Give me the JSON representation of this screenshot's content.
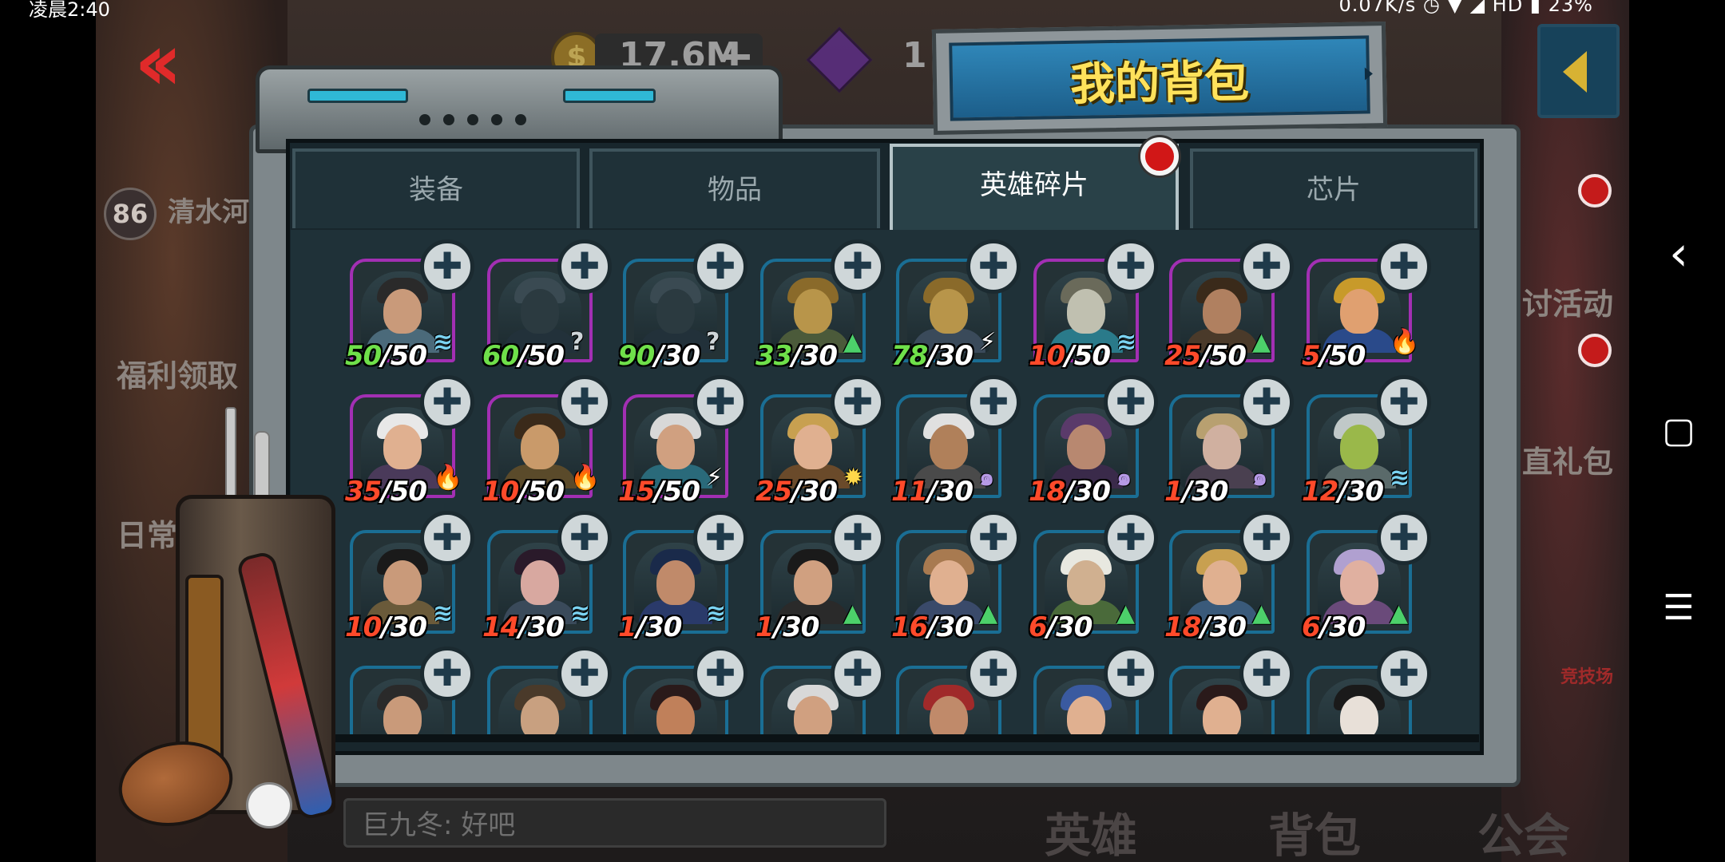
{
  "status_bar": {
    "time": "凌晨2:40",
    "right": "0.07K/s ◷ ▼ ◢ HD ▮ 23%"
  },
  "background": {
    "level": "86",
    "player_name": "清水河",
    "welfare_label": "福利领取",
    "daily_label": "日常任",
    "gold_amount": "17.6M",
    "gold_icon_glyph": "$",
    "plus_glyph": "+",
    "gem_amount": "1",
    "event_label": "讨活动",
    "gift_label": "直礼包",
    "arena_label": "竞技场",
    "chat_text": "巨九冬: 好吧",
    "bottom_tabs": [
      "英雄",
      "背包",
      "公会"
    ]
  },
  "panel": {
    "title": "我的背包",
    "tabs": [
      {
        "label": "装备",
        "active": false
      },
      {
        "label": "物品",
        "active": false
      },
      {
        "label": "英雄碎片",
        "active": true
      },
      {
        "label": "芯片",
        "active": false
      }
    ]
  },
  "element_icons": {
    "water": {
      "glyph": "≋",
      "icon": "water-element-icon"
    },
    "fire": {
      "glyph": "🔥",
      "icon": "fire-element-icon"
    },
    "bolt": {
      "glyph": "⚡",
      "icon": "lightning-element-icon"
    },
    "sun": {
      "glyph": "✹",
      "icon": "sun-element-icon"
    },
    "spiral": {
      "glyph": "๑",
      "icon": "spiral-element-icon"
    },
    "mount": {
      "glyph": "▲",
      "icon": "mountain-element-icon"
    },
    "unknown": {
      "glyph": "?",
      "icon": "unknown-element-icon"
    }
  },
  "puzzle_glyph": "✚",
  "android_nav": {
    "back": "‹",
    "home": "▢",
    "menu": "☰"
  },
  "hero_shards": [
    {
      "have": "50",
      "need": "/50",
      "frame": "purple",
      "element": "water",
      "have_color": "green",
      "skin": "#c99a7a",
      "hair": "#2a2a2a",
      "cloth": "#4b6a7a"
    },
    {
      "have": "60",
      "need": "/50",
      "frame": "purple",
      "element": "unknown",
      "have_color": "green",
      "skin": "#2b3a40",
      "hair": "#3a4a52",
      "cloth": "#22313a"
    },
    {
      "have": "90",
      "need": "/30",
      "frame": "blue",
      "element": "unknown",
      "have_color": "green",
      "skin": "#2b3a40",
      "hair": "#3a4a52",
      "cloth": "#22313a"
    },
    {
      "have": "33",
      "need": "/30",
      "frame": "blue",
      "element": "mount",
      "have_color": "green",
      "skin": "#b8954a",
      "hair": "#8a6a2a",
      "cloth": "#4b5a3a"
    },
    {
      "have": "78",
      "need": "/30",
      "frame": "blue",
      "element": "bolt",
      "have_color": "green",
      "skin": "#b8954a",
      "hair": "#8a6a2a",
      "cloth": "#3a4a5a"
    },
    {
      "have": "10",
      "need": "/50",
      "frame": "purple",
      "element": "water",
      "have_color": "red",
      "skin": "#c0c0b0",
      "hair": "#6a6a5a",
      "cloth": "#2a7a8a"
    },
    {
      "have": "25",
      "need": "/50",
      "frame": "purple",
      "element": "mount",
      "have_color": "red",
      "skin": "#b08060",
      "hair": "#3a2a1a",
      "cloth": "#4a3a2a"
    },
    {
      "have": "5",
      "need": "/50",
      "frame": "purple",
      "element": "fire",
      "have_color": "red",
      "skin": "#e0a070",
      "hair": "#c89a2a",
      "cloth": "#2a4a8a"
    },
    {
      "have": "35",
      "need": "/50",
      "frame": "purple",
      "element": "fire",
      "have_color": "red",
      "skin": "#e0b090",
      "hair": "#e8e8e8",
      "cloth": "#4a3a5a"
    },
    {
      "have": "10",
      "need": "/50",
      "frame": "purple",
      "element": "fire",
      "have_color": "red",
      "skin": "#c99a6a",
      "hair": "#3a2a1a",
      "cloth": "#5a4a2a"
    },
    {
      "have": "15",
      "need": "/50",
      "frame": "purple",
      "element": "bolt",
      "have_color": "red",
      "skin": "#d0a080",
      "hair": "#d8d8d8",
      "cloth": "#2a6a7a"
    },
    {
      "have": "25",
      "need": "/30",
      "frame": "blue",
      "element": "sun",
      "have_color": "red",
      "skin": "#e0b090",
      "hair": "#c8a050",
      "cloth": "#6a4a2a"
    },
    {
      "have": "11",
      "need": "/30",
      "frame": "blue",
      "element": "spiral",
      "have_color": "red",
      "skin": "#b0805a",
      "hair": "#e0e0e0",
      "cloth": "#4a4a4a"
    },
    {
      "have": "18",
      "need": "/30",
      "frame": "blue",
      "element": "spiral",
      "have_color": "red",
      "skin": "#b88870",
      "hair": "#5a3a6a",
      "cloth": "#3a2a4a"
    },
    {
      "have": "1",
      "need": "/30",
      "frame": "blue",
      "element": "spiral",
      "have_color": "red",
      "skin": "#d0b0a0",
      "hair": "#b8a070",
      "cloth": "#4a4050"
    },
    {
      "have": "12",
      "need": "/30",
      "frame": "blue",
      "element": "water",
      "have_color": "red",
      "skin": "#9ab84a",
      "hair": "#c0c8c8",
      "cloth": "#5a6a6a"
    },
    {
      "have": "10",
      "need": "/30",
      "frame": "blue",
      "element": "water",
      "have_color": "red",
      "skin": "#c99a7a",
      "hair": "#1a1a1a",
      "cloth": "#6a5a3a"
    },
    {
      "have": "14",
      "need": "/30",
      "frame": "blue",
      "element": "water",
      "have_color": "red",
      "skin": "#d8a8a0",
      "hair": "#2a1a2a",
      "cloth": "#3a4a5a"
    },
    {
      "have": "1",
      "need": "/30",
      "frame": "blue",
      "element": "water",
      "have_color": "red",
      "skin": "#c08a6a",
      "hair": "#1a2a4a",
      "cloth": "#2a3a6a"
    },
    {
      "have": "1",
      "need": "/30",
      "frame": "blue",
      "element": "mount",
      "have_color": "red",
      "skin": "#d0a080",
      "hair": "#1a1a1a",
      "cloth": "#2a2a2a"
    },
    {
      "have": "16",
      "need": "/30",
      "frame": "blue",
      "element": "mount",
      "have_color": "red",
      "skin": "#e0b090",
      "hair": "#a87a50",
      "cloth": "#3a4a6a"
    },
    {
      "have": "6",
      "need": "/30",
      "frame": "blue",
      "element": "mount",
      "have_color": "red",
      "skin": "#d0b090",
      "hair": "#e8e8e0",
      "cloth": "#4a6a3a"
    },
    {
      "have": "18",
      "need": "/30",
      "frame": "blue",
      "element": "mount",
      "have_color": "red",
      "skin": "#e0b090",
      "hair": "#c8a050",
      "cloth": "#3a5a7a"
    },
    {
      "have": "6",
      "need": "/30",
      "frame": "blue",
      "element": "mount",
      "have_color": "red",
      "skin": "#e0b0a0",
      "hair": "#b0a0d0",
      "cloth": "#6a4a7a"
    },
    {
      "have": "",
      "need": "",
      "frame": "blue",
      "element": "",
      "have_color": "red",
      "skin": "#c99a7a",
      "hair": "#2a2a2a",
      "cloth": "#5a4a2a"
    },
    {
      "have": "",
      "need": "",
      "frame": "blue",
      "element": "",
      "have_color": "red",
      "skin": "#c8a080",
      "hair": "#4a3a2a",
      "cloth": "#3a3a3a"
    },
    {
      "have": "",
      "need": "",
      "frame": "blue",
      "element": "",
      "have_color": "red",
      "skin": "#c0805a",
      "hair": "#2a1a1a",
      "cloth": "#6a2a2a"
    },
    {
      "have": "",
      "need": "",
      "frame": "blue",
      "element": "",
      "have_color": "red",
      "skin": "#d0a080",
      "hair": "#d8d8d8",
      "cloth": "#2a2a3a"
    },
    {
      "have": "",
      "need": "",
      "frame": "blue",
      "element": "",
      "have_color": "red",
      "skin": "#c08a6a",
      "hair": "#a02a2a",
      "cloth": "#3a2a2a"
    },
    {
      "have": "",
      "need": "",
      "frame": "blue",
      "element": "",
      "have_color": "red",
      "skin": "#e0b090",
      "hair": "#3a5aa0",
      "cloth": "#4a3a5a"
    },
    {
      "have": "",
      "need": "",
      "frame": "blue",
      "element": "",
      "have_color": "red",
      "skin": "#e0b090",
      "hair": "#2a1a1a",
      "cloth": "#3a4a6a"
    },
    {
      "have": "",
      "need": "",
      "frame": "blue",
      "element": "",
      "have_color": "red",
      "skin": "#e8e0d8",
      "hair": "#1a1a1a",
      "cloth": "#2a2a2a"
    }
  ]
}
